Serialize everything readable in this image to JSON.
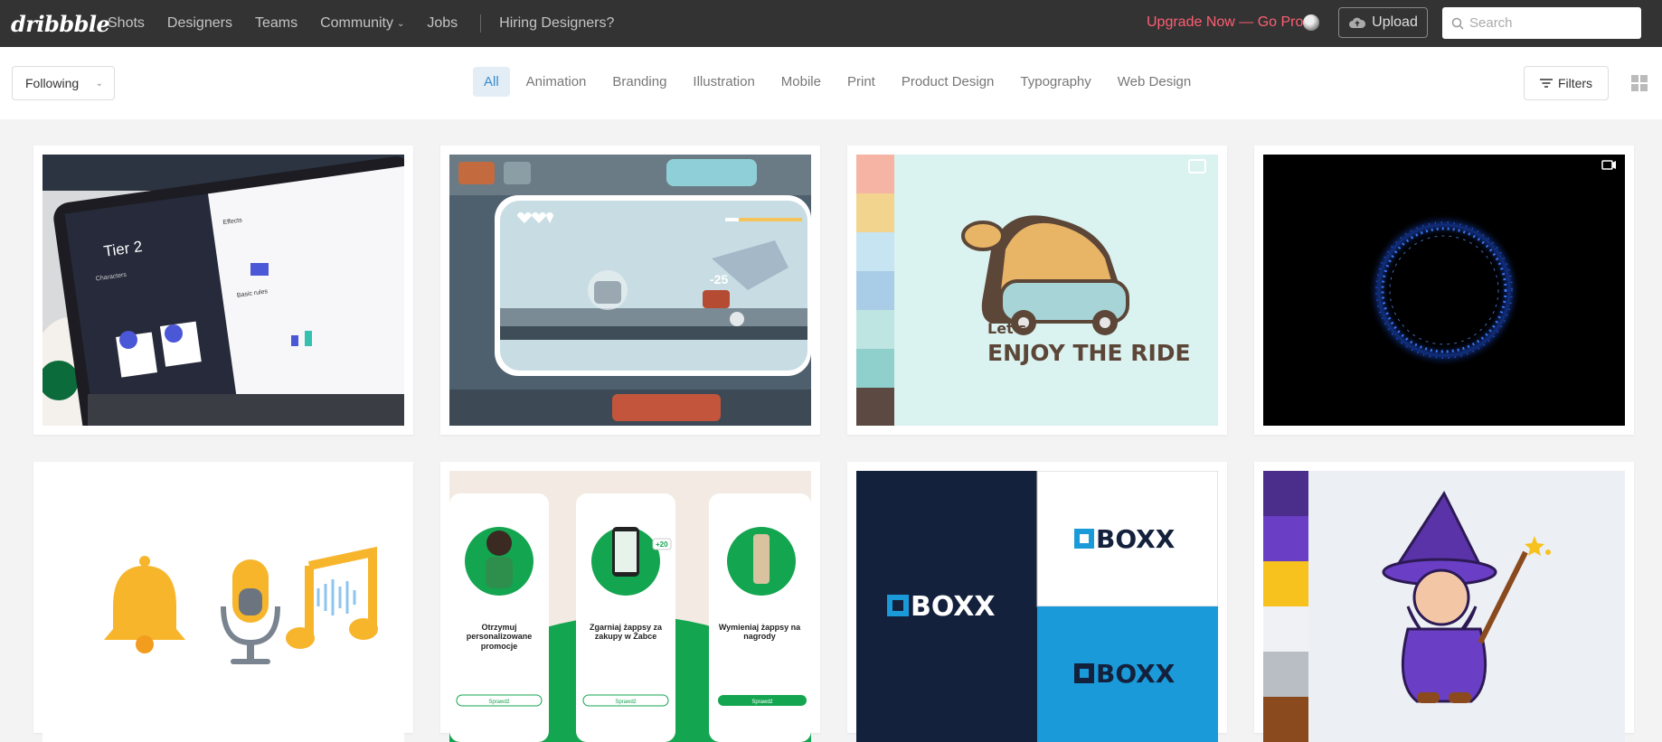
{
  "topbar": {
    "logo": "dribbble",
    "nav": [
      "Shots",
      "Designers",
      "Teams",
      "Community",
      "Jobs"
    ],
    "hiring": "Hiring Designers?",
    "upgrade": "Upgrade Now — Go Pro",
    "upload_label": "Upload",
    "search_placeholder": "Search"
  },
  "subbar": {
    "following": "Following",
    "categories": [
      "All",
      "Animation",
      "Branding",
      "Illustration",
      "Mobile",
      "Print",
      "Product Design",
      "Typography",
      "Web Design"
    ],
    "active_category": "All",
    "filters": "Filters"
  },
  "shots": [
    {
      "text": "Tier 2",
      "sub": [
        "Characters",
        "Effects",
        "Basic rules"
      ]
    },
    {
      "text": "-25"
    },
    {
      "text1": "Let's",
      "text2": "ENJOY THE RIDE",
      "palette": [
        "#f5b4a4",
        "#f2d48f",
        "#c7e4f3",
        "#a9cde6",
        "#bfe5e2",
        "#8fcfcc",
        "#5c4a42"
      ]
    },
    {},
    {},
    {
      "screens": [
        {
          "title": "Otrzymuj personalizowane promocje",
          "cta": "Sprawdź"
        },
        {
          "title": "Zgarniaj żappsy za zakupy w Żabce",
          "cta": "Sprawdź"
        },
        {
          "title": "Wymieniaj żappsy na nagrody",
          "cta": "Sprawdź"
        }
      ],
      "badge": "+20"
    },
    {
      "brand": "BOXX"
    },
    {
      "palette": [
        "#4b2d8c",
        "#6a3fc5",
        "#f7c21d",
        "#f0f1f5",
        "#b9bec4",
        "#8a4a1e"
      ]
    }
  ],
  "colors": {
    "topbar": "#333333",
    "accent": "#ff5e73",
    "active_cat_bg": "#e3edf6",
    "active_cat_text": "#3a8bcb"
  }
}
